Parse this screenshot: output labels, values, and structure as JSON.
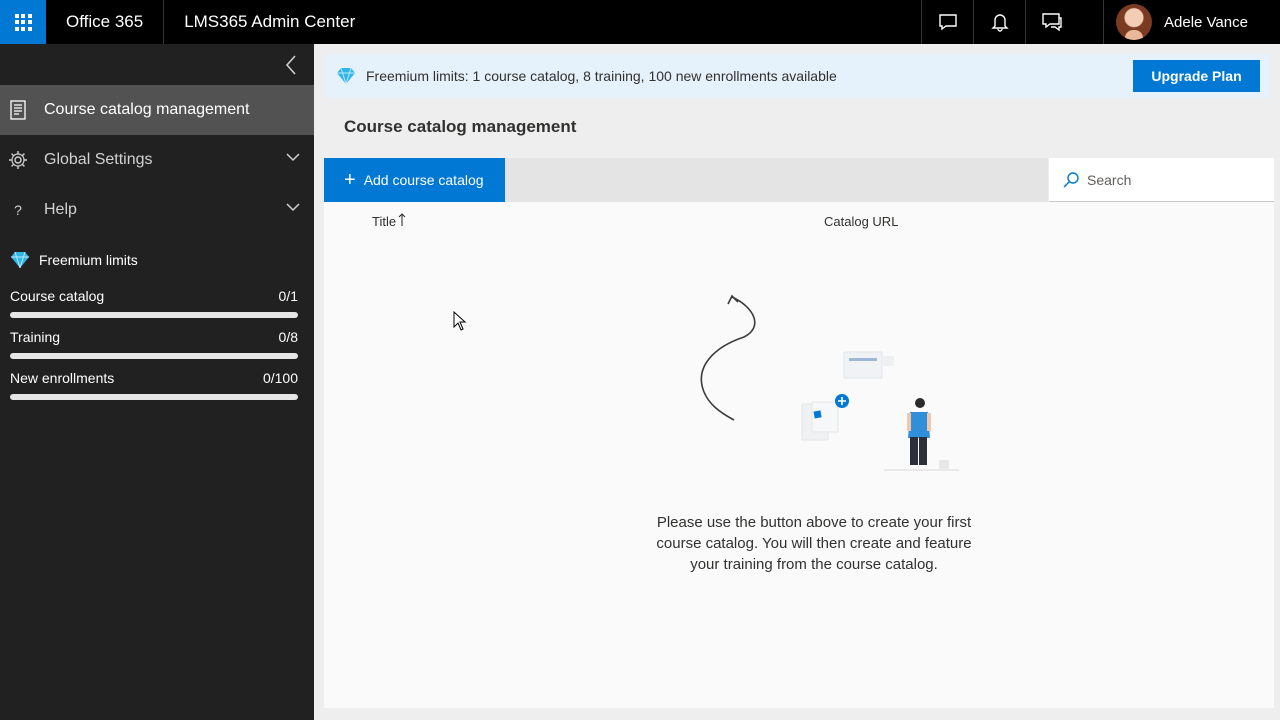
{
  "topbar": {
    "brand": "Office 365",
    "app_name": "LMS365 Admin Center",
    "user_name": "Adele Vance",
    "icons": [
      "app-launcher-icon",
      "chat-icon",
      "bell-icon",
      "feedback-icon"
    ]
  },
  "sidebar": {
    "items": [
      {
        "label": "Course catalog management",
        "icon": "catalog-icon",
        "active": true
      },
      {
        "label": "Global Settings",
        "icon": "gear-icon",
        "expandable": true
      },
      {
        "label": "Help",
        "icon": "question-icon",
        "expandable": true
      }
    ],
    "limits": {
      "title": "Freemium limits",
      "rows": [
        {
          "label": "Course catalog",
          "value": "0/1",
          "fraction": 0
        },
        {
          "label": "Training",
          "value": "0/8",
          "fraction": 0
        },
        {
          "label": "New enrollments",
          "value": "0/100",
          "fraction": 0
        }
      ]
    }
  },
  "banner": {
    "text": "Freemium limits: 1 course catalog, 8 training, 100 new enrollments available",
    "button_label": "Upgrade Plan"
  },
  "main": {
    "title": "Course catalog management",
    "add_button_label": "Add course catalog",
    "search_placeholder": "Search",
    "columns": [
      "Title",
      "Catalog URL"
    ],
    "empty_message": "Please use the button above to create your first course catalog. You will then create and feature your training from the course catalog."
  },
  "colors": {
    "accent": "#0078d4",
    "sidebar_bg": "#212121",
    "active_item_bg": "#525252",
    "banner_bg": "#e5f1fb"
  }
}
